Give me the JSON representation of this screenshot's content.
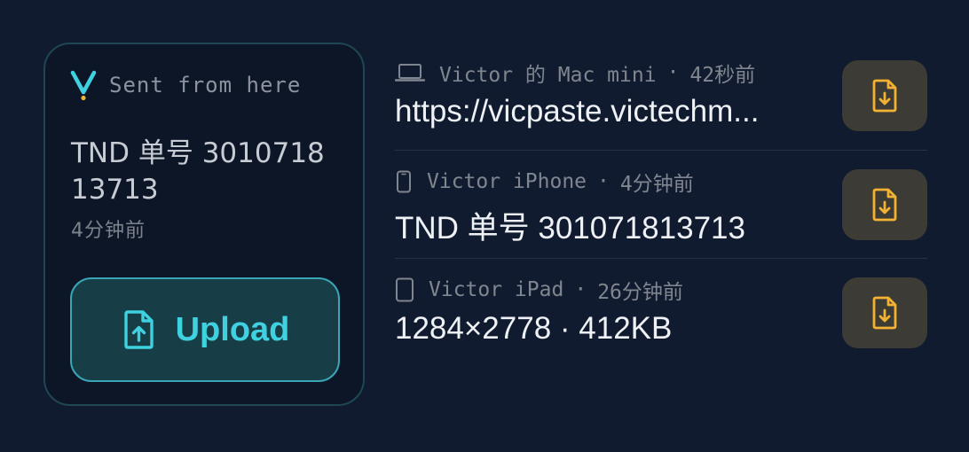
{
  "sent_card": {
    "label": "Sent from here",
    "content": "TND 单号 301071813713",
    "time": "4分钟前",
    "upload_label": "Upload"
  },
  "colors": {
    "background": "#111b2f",
    "accent_cyan": "#3fd1e0",
    "accent_gold": "#f2b233"
  },
  "clips": [
    {
      "device_icon": "laptop-icon",
      "device": "Victor 的 Mac mini",
      "separator": "·",
      "time": "42秒前",
      "text": "https://vicpaste.victechm..."
    },
    {
      "device_icon": "phone-icon",
      "device": "Victor iPhone",
      "separator": "·",
      "time": "4分钟前",
      "text": "TND 单号 301071813713"
    },
    {
      "device_icon": "tablet-icon",
      "device": "Victor iPad",
      "separator": "·",
      "time": "26分钟前",
      "text": "1284×2778 · 412KB"
    }
  ]
}
